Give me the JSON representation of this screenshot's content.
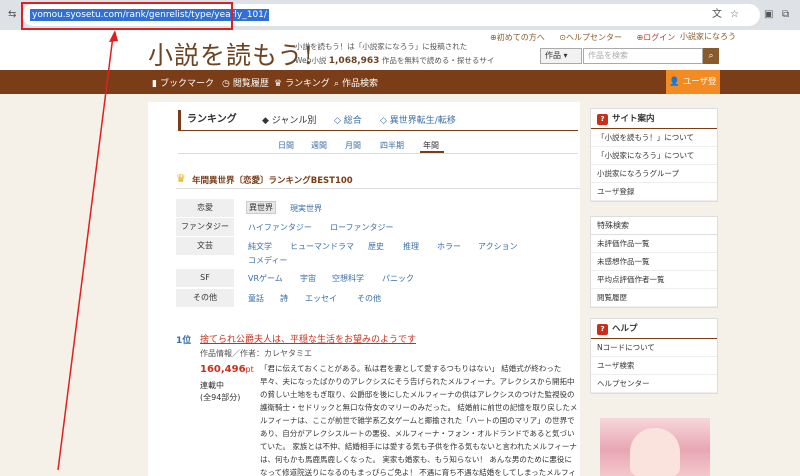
{
  "browser": {
    "url": "yomou.syosetu.com/rank/genrelist/type/yearly_101/"
  },
  "site": {
    "logo": "小説を読もう!",
    "tagline1": "小説を読もう！は「小説家になろう」に投稿された",
    "tagline2_pre": "Web小説",
    "tagline2_count": "1,068,963",
    "tagline2_post": "作品を無料で読める・探せるサイトです。",
    "links": [
      "初めての方へ",
      "ヘルプセンター",
      "ログイン"
    ],
    "partner_logo": "小説家になろう",
    "search_select": "作品",
    "search_placeholder": "作品を検索"
  },
  "nav": {
    "items": [
      {
        "icon": "bookmark-icon",
        "glyph": "▮",
        "label": "ブックマーク"
      },
      {
        "icon": "history-icon",
        "glyph": "◷",
        "label": "閲覧履歴"
      },
      {
        "icon": "ranking-icon",
        "glyph": "♛",
        "label": "ランキング"
      },
      {
        "icon": "search-icon",
        "glyph": "⌕",
        "label": "作品検索"
      }
    ],
    "register": "ユーザ登録"
  },
  "ranking": {
    "title": "ランキング",
    "tabs": [
      "◆ ジャンル別",
      "◇ 総合",
      "◇ 異世界転生/転移"
    ],
    "periods": [
      "日間",
      "週間",
      "月間",
      "四半期",
      "年間"
    ],
    "heading": "年間異世界〔恋愛〕ランキングBEST100"
  },
  "genres": [
    {
      "label": "恋愛",
      "links": [
        "異世界",
        "現実世界"
      ]
    },
    {
      "label": "ファンタジー",
      "links": [
        "ハイファンタジー",
        "ローファンタジー"
      ]
    },
    {
      "label": "文芸",
      "links": [
        "純文学",
        "ヒューマンドラマ",
        "歴史",
        "推理",
        "ホラー",
        "アクション",
        "コメディー"
      ]
    },
    {
      "label": "SF",
      "links": [
        "VRゲーム",
        "宇宙",
        "空想科学",
        "パニック"
      ]
    },
    {
      "label": "その他",
      "links": [
        "童話",
        "詩",
        "エッセイ",
        "その他"
      ]
    }
  ],
  "entry": {
    "position": "1位",
    "title": "捨てられ公爵夫人は、平穏な生活をお望みのようです",
    "meta": "作品情報／作者：カレヤタミエ",
    "points": "160,496",
    "points_unit": "pt",
    "status1": "連載中",
    "status2": "(全94部分)",
    "synopsis": "「君に伝えておくことがある。私は君を妻として愛するつもりはない」 結婚式が終わった早々、夫になったばかりのアレクシスにそう告げられたメルフィーナ。アレクシスから開拓中の貧しい土地をもぎ取り、公爵邸を後にしたメルフィーナの供はアレクシスのつけた監視役の護衛騎士・セドリックと無口な侍女のマリーのみだった。 結婚前に前世の記憶を取り戻したメルフィーナは、ここが前世で雑学系乙女ゲームと揶揄された「ハートの国のマリア」の世界であり、自分がアレクシスルートの悪役、メルフィーナ・フォン・オルドランドであると気づいていた。 家族とは不仲、結婚相手には愛する気も子供を作る気もないと言われたメルフィーナは、何もかも馬鹿馬鹿しくなった。 実家も婚家も、もう知らない！ あんな男のために悪役になって修道院送りになるのもまっぴらご免よ！ 不遇に育ち不遇な結婚をしてしまったメルフィーナは、家族も夫も関係なく結婚に幸せになろうと決意するのだった。"
  },
  "sidebar": {
    "guide_title": "サイト案内",
    "guide_items": [
      "「小説を読もう！」について",
      "「小説家になろう」について",
      "小説家になろうグループ",
      "ユーザ登録"
    ],
    "special_title": "特殊検索",
    "special_items": [
      "未評価作品一覧",
      "未感想作品一覧",
      "平均点評価作者一覧",
      "閲覧履歴"
    ],
    "help_title": "ヘルプ",
    "help_items": [
      "Nコードについて",
      "ユーザ検索",
      "ヘルプセンター"
    ]
  },
  "colors": {
    "brand_brown": "#7a3d17",
    "register_orange": "#f28c22",
    "title_red": "#c9301c",
    "annotation_red": "#e02020"
  }
}
